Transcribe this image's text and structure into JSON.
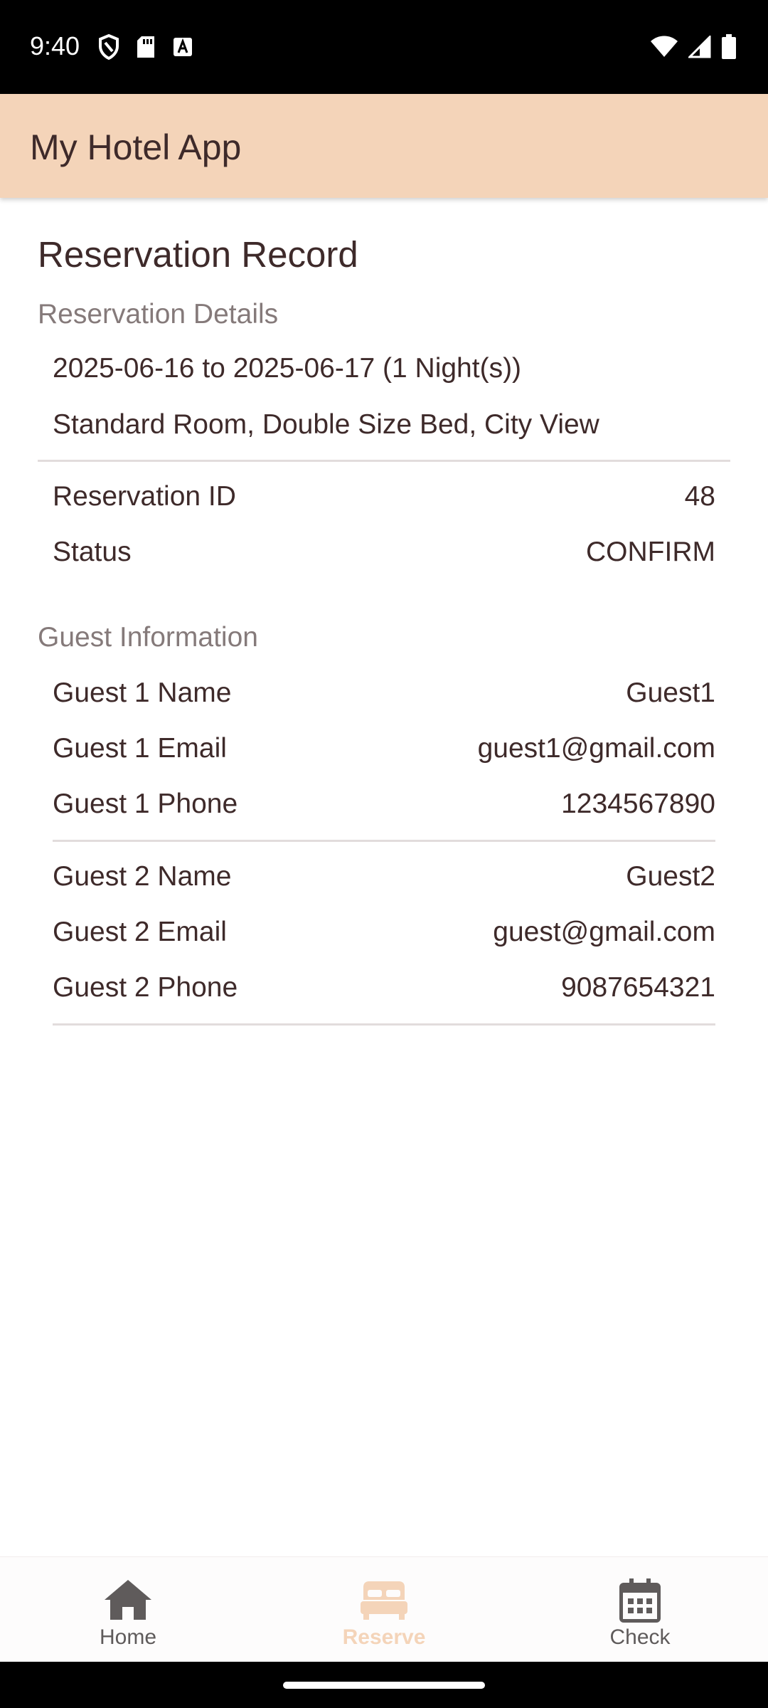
{
  "status_bar": {
    "time": "9:40"
  },
  "app_bar": {
    "title": "My Hotel App"
  },
  "page": {
    "title": "Reservation Record",
    "reservation_details_label": "Reservation Details",
    "date_range": "2025-06-16 to 2025-06-17 (1 Night(s))",
    "room_description": "Standard Room, Double Size Bed, City View",
    "reservation_rows": [
      {
        "key": "Reservation ID",
        "value": "48"
      },
      {
        "key": "Status",
        "value": "CONFIRM"
      }
    ],
    "guest_information_label": "Guest Information",
    "guests": [
      {
        "name_key": "Guest 1 Name",
        "name": "Guest1",
        "email_key": "Guest 1 Email",
        "email": "guest1@gmail.com",
        "phone_key": "Guest 1 Phone",
        "phone": "1234567890"
      },
      {
        "name_key": "Guest 2 Name",
        "name": "Guest2",
        "email_key": "Guest 2 Email",
        "email": "guest@gmail.com",
        "phone_key": "Guest 2 Phone",
        "phone": "9087654321"
      }
    ]
  },
  "bottom_nav": {
    "items": [
      {
        "label": "Home",
        "icon": "home-icon",
        "active": false
      },
      {
        "label": "Reserve",
        "icon": "bed-icon",
        "active": true
      },
      {
        "label": "Check",
        "icon": "calendar-icon",
        "active": false
      }
    ],
    "active_color": "#f4d4b9",
    "inactive_color": "#5f5b5b"
  },
  "colors": {
    "app_bar": "#f4d4b9",
    "text_primary": "#3e2a2a",
    "text_secondary": "#857a7a"
  }
}
